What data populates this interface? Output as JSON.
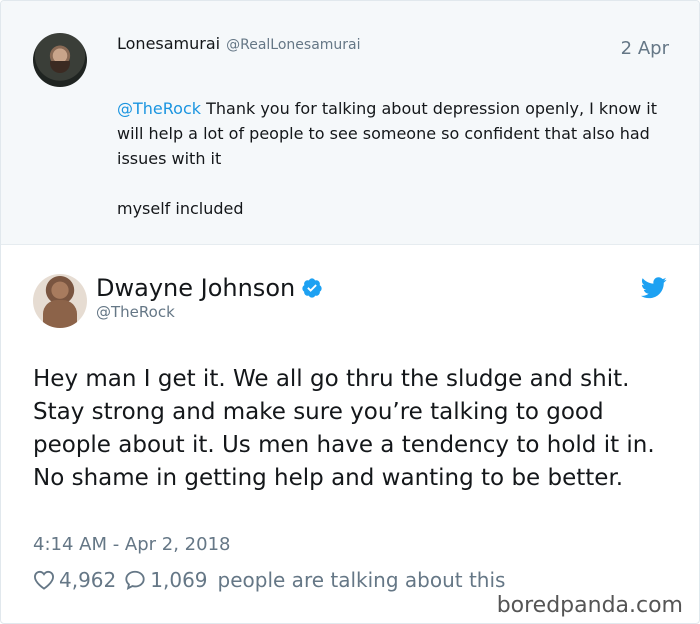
{
  "parent_tweet": {
    "author_name": "Lonesamurai",
    "author_handle": "@RealLonesamurai",
    "date": "2 Apr",
    "mention": "@TheRock",
    "text_main": " Thank you for talking about depression openly, I know it will help a lot of people to see someone so confident that also had issues with it",
    "text_second": "myself included"
  },
  "main_tweet": {
    "author_name": "Dwayne Johnson",
    "author_handle": "@TheRock",
    "verified_icon": "verified-badge-icon",
    "brand_icon": "twitter-bird-icon",
    "text": "Hey man I get it. We all go thru the sludge and shit. Stay strong and make sure you’re talking to good people about it. Us men have a tendency to hold it in. No shame in getting help and wanting to be better.",
    "timestamp": "4:14 AM - Apr 2, 2018",
    "likes": "4,962",
    "replies": "1,069",
    "talking_label": "people are talking about this"
  },
  "watermark": "boredpanda.com",
  "colors": {
    "link": "#1b95e0",
    "secondary_text": "#657786",
    "parent_bg": "#f5f8fa",
    "twitter_blue": "#1da1f2"
  }
}
